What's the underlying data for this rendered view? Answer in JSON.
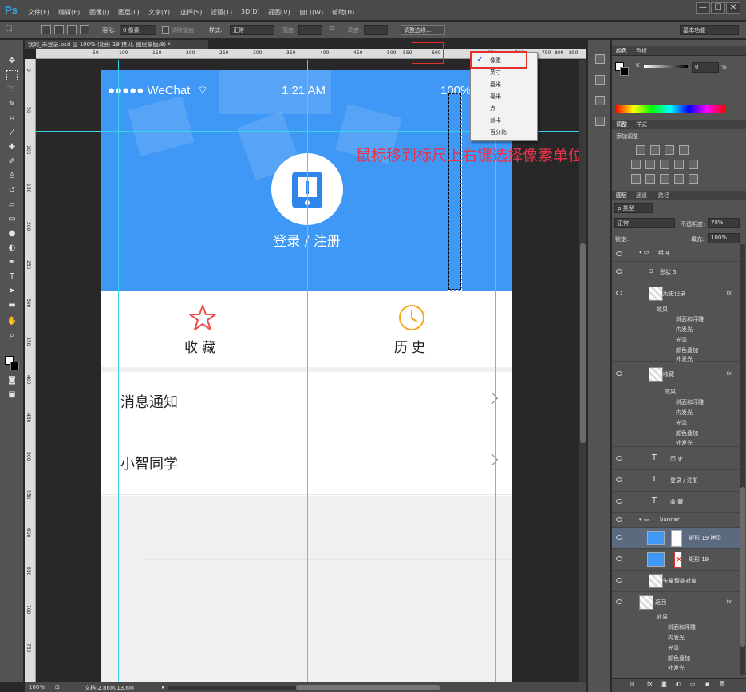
{
  "app": {
    "logo": "Ps",
    "menus": [
      "文件(F)",
      "编辑(E)",
      "图像(I)",
      "图层(L)",
      "文字(Y)",
      "选择(S)",
      "滤镜(T)",
      "3D(D)",
      "视图(V)",
      "窗口(W)",
      "帮助(H)"
    ],
    "window_buttons": [
      "—",
      "☐",
      "✕"
    ]
  },
  "options": {
    "feather_label": "羽化:",
    "feather_value": "0 像素",
    "antialias_label": "消除锯齿",
    "style_label": "样式:",
    "style_value": "正常",
    "width_label": "宽度:",
    "height_label": "高度:",
    "refine_edge": "调整边缘...",
    "workspace": "基本功能"
  },
  "document": {
    "tab_title": "我的_未登录.psd @ 100% (矩形 19 拷贝, 图层蒙版/8) *",
    "zoom": "100%",
    "doc_size": "文档:2.86M/13.6M"
  },
  "ruler": {
    "top_ticks": [
      "50",
      "100",
      "150",
      "200",
      "250",
      "300",
      "350",
      "400",
      "450",
      "500",
      "550",
      "600",
      "650",
      "700",
      "750",
      "800",
      "850"
    ],
    "left_ticks": [
      "0",
      "50",
      "100",
      "150",
      "200",
      "250",
      "300",
      "350",
      "400",
      "450",
      "500",
      "550",
      "600",
      "650",
      "700",
      "750"
    ]
  },
  "unit_menu": {
    "items": [
      "像素",
      "英寸",
      "厘米",
      "毫米",
      "点",
      "派卡",
      "百分比"
    ],
    "checked_index": 0
  },
  "annotation": "鼠标移到标尺上右键选择像素单位",
  "mockup": {
    "status_left": "●●●●● WeChat",
    "status_time": "1:21 AM",
    "status_battery": "100%",
    "login_text": "登录 / 注册",
    "quick_actions": [
      {
        "label": "收藏",
        "icon": "star-icon"
      },
      {
        "label": "历史",
        "icon": "clock-icon"
      }
    ],
    "list_rows": [
      {
        "label": "消息通知"
      },
      {
        "label": "小智同学"
      }
    ],
    "colors": {
      "banner": "#3f97f6",
      "star": "#ef4d4d",
      "clock": "#f5a623"
    }
  },
  "panels": {
    "color_tabs": [
      "颜色",
      "色板"
    ],
    "color_k_label": "K",
    "color_k_value": "0",
    "color_k_unit": "%",
    "adjust_tabs": [
      "调整",
      "样式"
    ],
    "adjust_title": "添加调整",
    "layer_tabs": [
      "图层",
      "通道",
      "路径"
    ],
    "kind_label": "ρ 类型",
    "blend_mode": "正常",
    "opacity_label": "不透明度:",
    "opacity_value": "70%",
    "lock_label": "锁定:",
    "fill_label": "填充:",
    "fill_value": "100%",
    "layers": [
      {
        "name": "组 4",
        "type": "group"
      },
      {
        "name": "形状 5",
        "type": "shape"
      },
      {
        "name": "历史记录",
        "type": "smart",
        "fx": true,
        "effects_title": "效果",
        "effects": [
          "斜面和浮雕",
          "内发光",
          "光泽",
          "颜色叠加",
          "外发光"
        ]
      },
      {
        "name": "收藏",
        "type": "smart",
        "fx": true,
        "effects_title": "效果",
        "effects": [
          "斜面和浮雕",
          "内发光",
          "光泽",
          "颜色叠加",
          "外发光"
        ]
      },
      {
        "name": "历 史",
        "type": "text"
      },
      {
        "name": "登录 / 注册",
        "type": "text"
      },
      {
        "name": "收 藏",
        "type": "text"
      },
      {
        "name": "banner",
        "type": "group"
      },
      {
        "name": "矩形 19 拷贝",
        "type": "rect-mask",
        "selected": true
      },
      {
        "name": "矩形 19",
        "type": "rect-mask2"
      },
      {
        "name": "矢量智能对象",
        "type": "smart"
      },
      {
        "name": "返回",
        "type": "smart",
        "fx": true,
        "effects_title": "效果",
        "effects": [
          "斜面和浮雕",
          "内发光",
          "光泽",
          "颜色叠加",
          "外发光"
        ]
      }
    ]
  }
}
